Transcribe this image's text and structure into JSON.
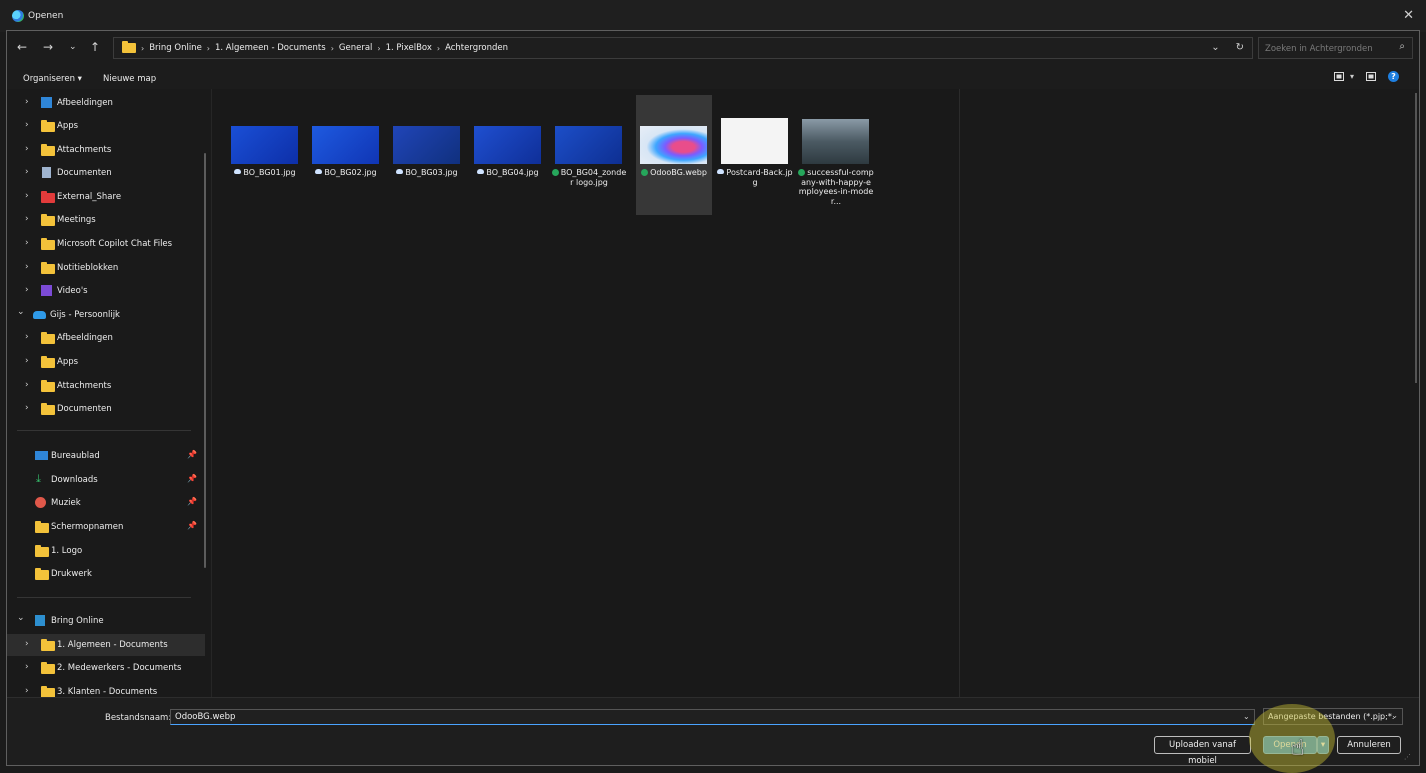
{
  "window": {
    "title": "Openen",
    "close_label": "✕"
  },
  "address": {
    "crumbs": [
      "Bring Online",
      "1. Algemeen - Documents",
      "General",
      "1. PixelBox",
      "Achtergronden"
    ],
    "search_placeholder": "Zoeken in Achtergronden"
  },
  "toolbar": {
    "organize_label": "Organiseren ▾",
    "new_folder_label": "Nieuwe map"
  },
  "nav": {
    "items": [
      {
        "label": "Afbeeldingen",
        "icon": "pictures-icon"
      },
      {
        "label": "Apps",
        "icon": "folder-icon"
      },
      {
        "label": "Attachments",
        "icon": "folder-icon"
      },
      {
        "label": "Documenten",
        "icon": "documents-icon"
      },
      {
        "label": "External_Share",
        "icon": "folder-red-icon"
      },
      {
        "label": "Meetings",
        "icon": "folder-icon"
      },
      {
        "label": "Microsoft Copilot Chat Files",
        "icon": "folder-icon"
      },
      {
        "label": "Notitieblokken",
        "icon": "folder-icon"
      },
      {
        "label": "Video's",
        "icon": "video-icon"
      },
      {
        "label": "Gijs - Persoonlijk",
        "icon": "onedrive-icon"
      },
      {
        "label": "Afbeeldingen",
        "icon": "folder-icon"
      },
      {
        "label": "Apps",
        "icon": "folder-icon"
      },
      {
        "label": "Attachments",
        "icon": "folder-icon"
      },
      {
        "label": "Documenten",
        "icon": "folder-icon"
      }
    ],
    "quick": [
      {
        "label": "Bureaublad",
        "icon": "desktop-icon",
        "pinned": true
      },
      {
        "label": "Downloads",
        "icon": "download-icon",
        "pinned": true
      },
      {
        "label": "Muziek",
        "icon": "music-icon",
        "pinned": true
      },
      {
        "label": "Schermopnamen",
        "icon": "folder-icon",
        "pinned": true
      },
      {
        "label": "1. Logo",
        "icon": "folder-icon",
        "pinned": false
      },
      {
        "label": "Drukwerk",
        "icon": "folder-icon",
        "pinned": false
      }
    ],
    "org": [
      {
        "label": "Bring Online",
        "icon": "sharepoint-icon"
      },
      {
        "label": "1. Algemeen - Documents",
        "icon": "folder-icon"
      },
      {
        "label": "2. Medewerkers - Documents",
        "icon": "folder-icon"
      },
      {
        "label": "3. Klanten - Documents",
        "icon": "folder-icon"
      }
    ]
  },
  "files": [
    {
      "name": "BO_BG01.jpg",
      "status": "cloud"
    },
    {
      "name": "BO_BG02.jpg",
      "status": "cloud"
    },
    {
      "name": "BO_BG03.jpg",
      "status": "cloud"
    },
    {
      "name": "BO_BG04.jpg",
      "status": "cloud"
    },
    {
      "name": "BO_BG04_zonder logo.jpg",
      "status": "synced"
    },
    {
      "name": "OdooBG.webp",
      "status": "synced"
    },
    {
      "name": "Postcard-Back.jpg",
      "status": "cloud"
    },
    {
      "name": "successful-company-with-happy-employees-in-moder...",
      "status": "synced"
    }
  ],
  "bottom": {
    "filename_label": "Bestandsnaam:",
    "filename_value": "OdooBG.webp",
    "filter_label": "Aangepaste bestanden (*.pjp;*.",
    "upload_label": "Uploaden vanaf mobiel",
    "open_label": "Openen",
    "cancel_label": "Annuleren"
  },
  "colors": {
    "accent": "#3c8ecd",
    "folder": "#f3c23a",
    "synced": "#26a65b"
  }
}
